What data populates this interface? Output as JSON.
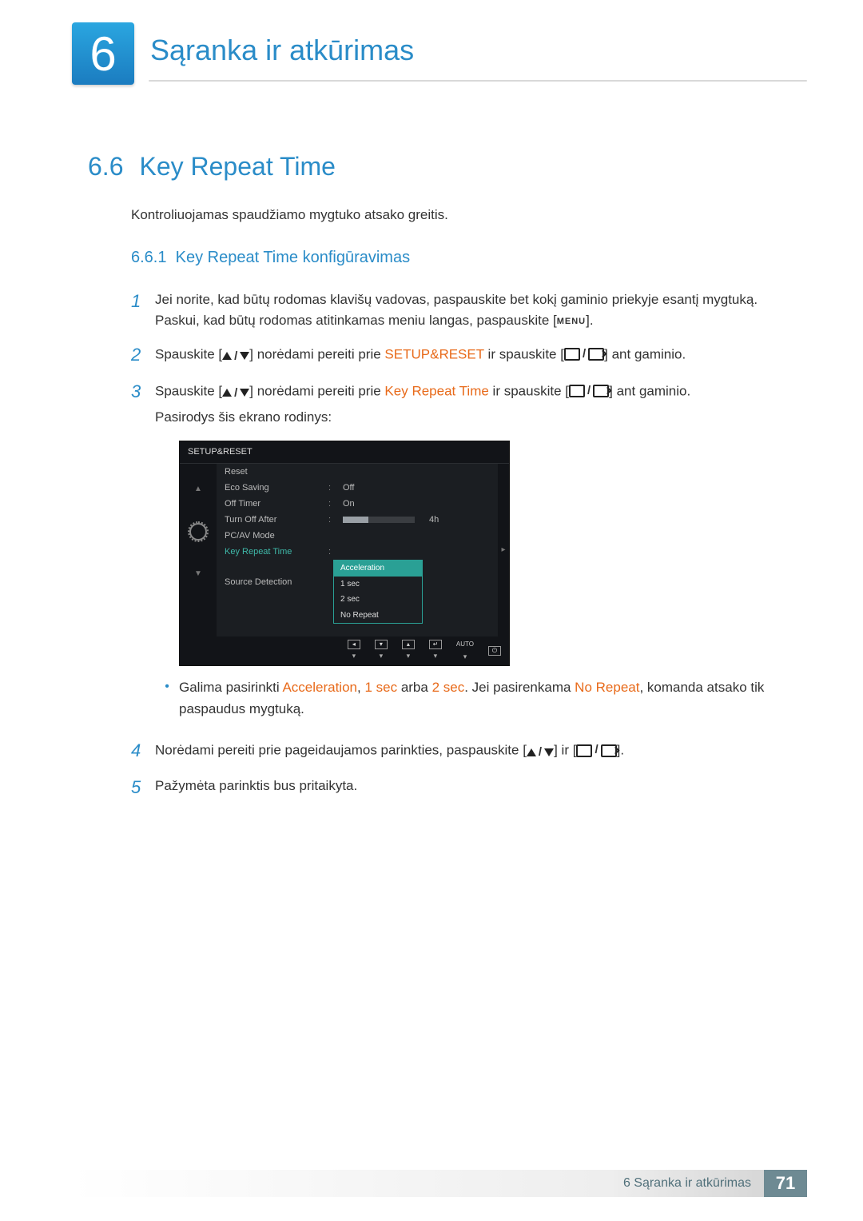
{
  "chapter": {
    "num": "6",
    "title": "Sąranka ir atkūrimas"
  },
  "section": {
    "num": "6.6",
    "title": "Key Repeat Time"
  },
  "intro": "Kontroliuojamas spaudžiamo mygtuko atsako greitis.",
  "subsection": {
    "num": "6.6.1",
    "title": "Key Repeat Time konfigūravimas"
  },
  "steps": {
    "s1a": "Jei norite, kad būtų rodomas klavišų vadovas, paspauskite bet kokį gaminio priekyje esantį mygtuką. Paskui, kad būtų rodomas atitinkamas meniu langas, paspauskite [",
    "s1b": "].",
    "s2a": "Spauskite [",
    "s2b": "] norėdami pereiti prie ",
    "s2c": " ir spauskite [",
    "s2d": "] ant gaminio.",
    "s3a": "Spauskite [",
    "s3b": "] norėdami pereiti prie ",
    "s3c": " ir spauskite [",
    "s3d": "] ant gaminio.",
    "s3e": "Pasirodys šis ekrano rodinys:",
    "note_a": "Galima pasirinkti ",
    "note_b": ", ",
    "note_c": " arba ",
    "note_d": ". Jei pasirenkama ",
    "note_e": ", komanda atsako tik paspaudus mygtuką.",
    "s4a": "Norėdami pereiti prie pageidaujamos parinkties, paspauskite [",
    "s4b": "] ir [",
    "s4c": "].",
    "s5": "Pažymėta parinktis bus pritaikyta."
  },
  "kw": {
    "setup_reset": "SETUP&RESET",
    "key_repeat": "Key Repeat Time",
    "accel": "Acceleration",
    "one_sec": "1 sec",
    "two_sec": "2 sec",
    "no_repeat": "No Repeat",
    "menu": "MENU"
  },
  "osd": {
    "title": "SETUP&RESET",
    "rows": {
      "reset": "Reset",
      "eco": "Eco Saving",
      "eco_v": "Off",
      "off_timer": "Off Timer",
      "off_timer_v": "On",
      "turn_off": "Turn Off After",
      "turn_off_v": "4h",
      "pcav": "PC/AV Mode",
      "krt": "Key Repeat Time",
      "src": "Source Detection"
    },
    "options": {
      "o1": "Acceleration",
      "o2": "1 sec",
      "o3": "2 sec",
      "o4": "No Repeat"
    },
    "bottom": {
      "auto": "AUTO"
    }
  },
  "footer": {
    "text": "6 Sąranka ir atkūrimas",
    "page": "71"
  }
}
